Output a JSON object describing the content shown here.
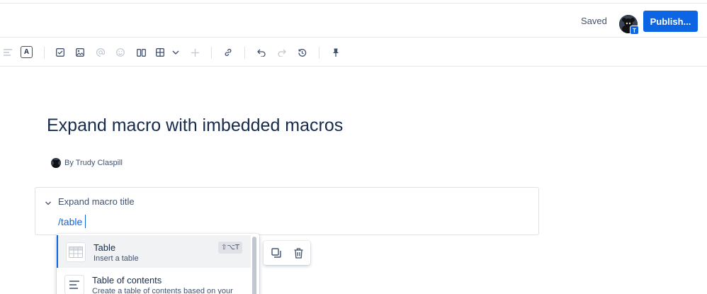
{
  "header": {
    "status": "Saved",
    "avatar_badge": "T",
    "publish_label": "Publish..."
  },
  "toolbar": {
    "items": [
      "align-left-icon",
      "text-color-icon",
      "checkbox-icon",
      "image-icon",
      "mention-icon",
      "emoji-icon",
      "layout-icon",
      "table-icon",
      "chevron-down-icon",
      "plus-icon",
      "link-icon",
      "undo-icon",
      "redo-icon",
      "history-icon",
      "pin-icon"
    ],
    "text_color_label": "A"
  },
  "page": {
    "title": "Expand macro with imbedded macros",
    "byline": "By Trudy Claspill"
  },
  "expand": {
    "title": "Expand macro title",
    "input_text": "/table"
  },
  "menu": {
    "items": [
      {
        "title": "Table",
        "description": "Insert a table",
        "shortcut": "⇧⌥T",
        "icon": "table-icon"
      },
      {
        "title": "Table of contents",
        "description": "Create a table of contents based on your",
        "icon": "toc-icon"
      }
    ]
  },
  "floating_toolbar": {
    "items": [
      "copy-icon",
      "trash-icon"
    ]
  },
  "colors": {
    "accent": "#0c66e4",
    "text": "#172b4d",
    "subtle": "#42526e",
    "border": "#dfe1e6"
  }
}
